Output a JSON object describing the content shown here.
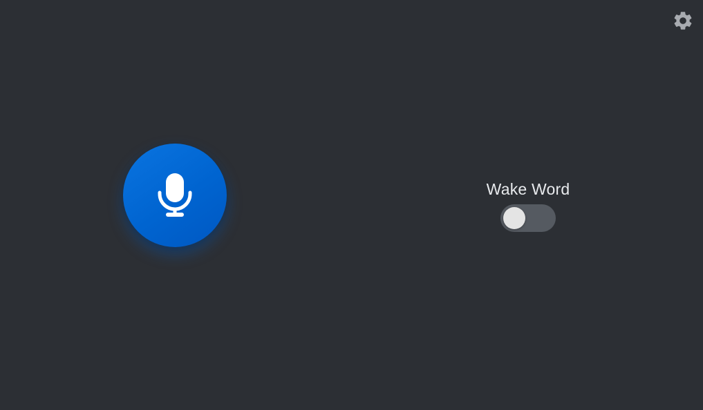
{
  "settings": {
    "icon": "gear-icon",
    "color": "#a8abb0"
  },
  "mic_button": {
    "icon": "microphone-icon",
    "color": "#0a6fdc"
  },
  "wake_word": {
    "label": "Wake Word",
    "enabled": false
  },
  "colors": {
    "background": "#2c2f34",
    "accent": "#0a6fdc",
    "toggle_track_off": "#555a61",
    "toggle_knob": "#e4e4e4"
  }
}
